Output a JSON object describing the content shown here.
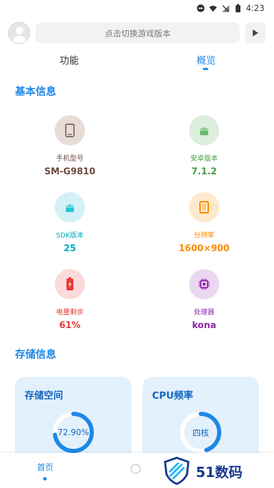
{
  "status_bar": {
    "time": "4:23"
  },
  "header": {
    "search_placeholder": "点击切换游戏版本"
  },
  "tabs": [
    {
      "label": "功能"
    },
    {
      "label": "概览"
    }
  ],
  "sections": {
    "basic_title": "基本信息",
    "storage_title": "存储信息"
  },
  "info": [
    {
      "label": "手机型号",
      "value": "SM-G9810",
      "color": "#6d4c41",
      "bg": "#e6dcd8",
      "icon": "phone-icon"
    },
    {
      "label": "安卓版本",
      "value": "7.1.2",
      "color": "#43a047",
      "bg": "#dcefdc",
      "icon": "android-icon"
    },
    {
      "label": "SDK版本",
      "value": "25",
      "color": "#00acc1",
      "bg": "#d3f1f6",
      "icon": "sdk-android-icon"
    },
    {
      "label": "分辨率",
      "value": "1600×900",
      "color": "#fb8c00",
      "bg": "#ffe9cc",
      "icon": "screen-icon"
    },
    {
      "label": "电量剩余",
      "value": "61%",
      "color": "#e53935",
      "bg": "#fcdada",
      "icon": "battery-icon"
    },
    {
      "label": "处理器",
      "value": "kona",
      "color": "#8e24aa",
      "bg": "#ead7f1",
      "icon": "chip-icon"
    }
  ],
  "cards": {
    "storage": {
      "title": "存储空间",
      "value_label": "72.90%",
      "fraction": 0.729
    },
    "cpu": {
      "title": "CPU频率",
      "value_label": "四核",
      "fraction": 0.45
    }
  },
  "bottom_nav": {
    "home_label": "首页"
  },
  "watermark": {
    "text": "51数码"
  },
  "colors": {
    "accent": "#1e88e5",
    "card_bg": "#e3f1fc"
  }
}
